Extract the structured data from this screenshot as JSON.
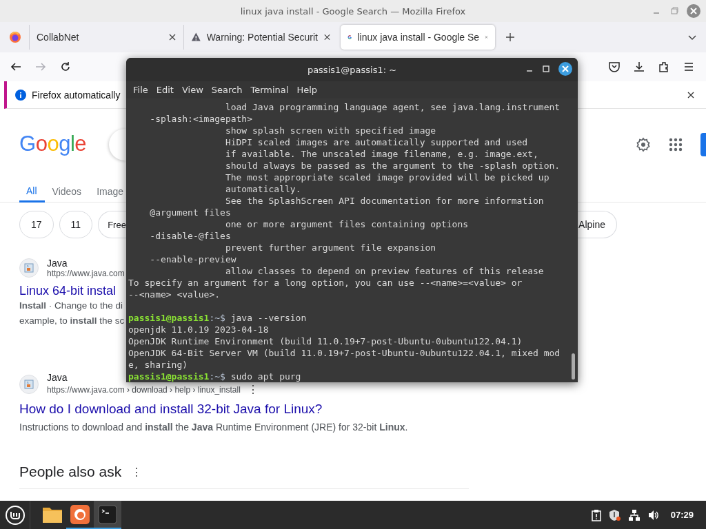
{
  "window": {
    "title": "linux java install - Google Search — Mozilla Firefox"
  },
  "tabs": [
    {
      "label": "CollabNet",
      "kind": "plain",
      "selected": false
    },
    {
      "label": "Warning: Potential Securit",
      "kind": "warning",
      "selected": false
    },
    {
      "label": "linux java install - Google Se",
      "kind": "google",
      "selected": true
    }
  ],
  "nav_buttons": [
    {
      "kind": "back",
      "disabled": false
    },
    {
      "kind": "forward",
      "disabled": true
    },
    {
      "kind": "reload",
      "disabled": false
    }
  ],
  "notification": {
    "text": "Firefox automatically"
  },
  "google": {
    "logo": "Google",
    "search_tabs": [
      {
        "label": "All",
        "selected": true
      },
      {
        "label": "Videos",
        "selected": false
      },
      {
        "label": "Image",
        "selected": false
      }
    ],
    "chips": [
      "17",
      "11",
      "Free"
    ],
    "chips_right": [
      "Alpine"
    ],
    "results": [
      {
        "site": "Java",
        "url": "https://www.java.com",
        "title": "Linux 64-bit instal",
        "snippet": [
          "**Install** · Change to the di",
          "example, to **install** the sc"
        ]
      },
      {
        "site": "Java",
        "url": "https://www.java.com › download › help › linux_install",
        "more": "⋮",
        "title": "How do I download and install 32-bit Java for Linux?",
        "snippet": [
          "Instructions to download and **install** the **Java** Runtime Environment (JRE) for 32-bit **Linux**."
        ]
      }
    ],
    "people_also_ask": {
      "title": "People also ask",
      "more": "⋮"
    }
  },
  "terminal": {
    "title": "passis1@passis1: ~",
    "menu": [
      "File",
      "Edit",
      "View",
      "Search",
      "Terminal",
      "Help"
    ],
    "lines": [
      {
        "kind": "output",
        "text": "                  load Java programming language agent, see java.lang.instrument"
      },
      {
        "kind": "output",
        "text": "    -splash:<imagepath>"
      },
      {
        "kind": "output",
        "text": "                  show splash screen with specified image"
      },
      {
        "kind": "output",
        "text": "                  HiDPI scaled images are automatically supported and used"
      },
      {
        "kind": "output",
        "text": "                  if available. The unscaled image filename, e.g. image.ext,"
      },
      {
        "kind": "output",
        "text": "                  should always be passed as the argument to the -splash option."
      },
      {
        "kind": "output",
        "text": "                  The most appropriate scaled image provided will be picked up"
      },
      {
        "kind": "output",
        "text": "                  automatically."
      },
      {
        "kind": "output",
        "text": "                  See the SplashScreen API documentation for more information"
      },
      {
        "kind": "output",
        "text": "    @argument files"
      },
      {
        "kind": "output",
        "text": "                  one or more argument files containing options"
      },
      {
        "kind": "output",
        "text": "    -disable-@files"
      },
      {
        "kind": "output",
        "text": "                  prevent further argument file expansion"
      },
      {
        "kind": "output",
        "text": "    --enable-preview"
      },
      {
        "kind": "output",
        "text": "                  allow classes to depend on preview features of this release"
      },
      {
        "kind": "output",
        "text": "To specify an argument for a long option, you can use --<name>=<value> or"
      },
      {
        "kind": "output",
        "text": "--<name> <value>."
      },
      {
        "kind": "blank"
      },
      {
        "kind": "prompt",
        "user": "passis1@passis1",
        "path": ":~$",
        "command": "java --version"
      },
      {
        "kind": "output",
        "text": "openjdk 11.0.19 2023-04-18"
      },
      {
        "kind": "output",
        "text": "OpenJDK Runtime Environment (build 11.0.19+7-post-Ubuntu-0ubuntu122.04.1)"
      },
      {
        "kind": "output",
        "text": "OpenJDK 64-Bit Server VM (build 11.0.19+7-post-Ubuntu-0ubuntu122.04.1, mixed mod"
      },
      {
        "kind": "output",
        "text": "e, sharing)"
      },
      {
        "kind": "prompt",
        "user": "passis1@passis1",
        "path": ":~$",
        "command": "sudo apt purg"
      }
    ]
  },
  "taskbar": {
    "apps": [
      {
        "kind": "files",
        "running": false,
        "active": false
      },
      {
        "kind": "firefox",
        "running": true,
        "active": false
      },
      {
        "kind": "terminal",
        "running": true,
        "active": true
      }
    ],
    "time": "07:29"
  }
}
